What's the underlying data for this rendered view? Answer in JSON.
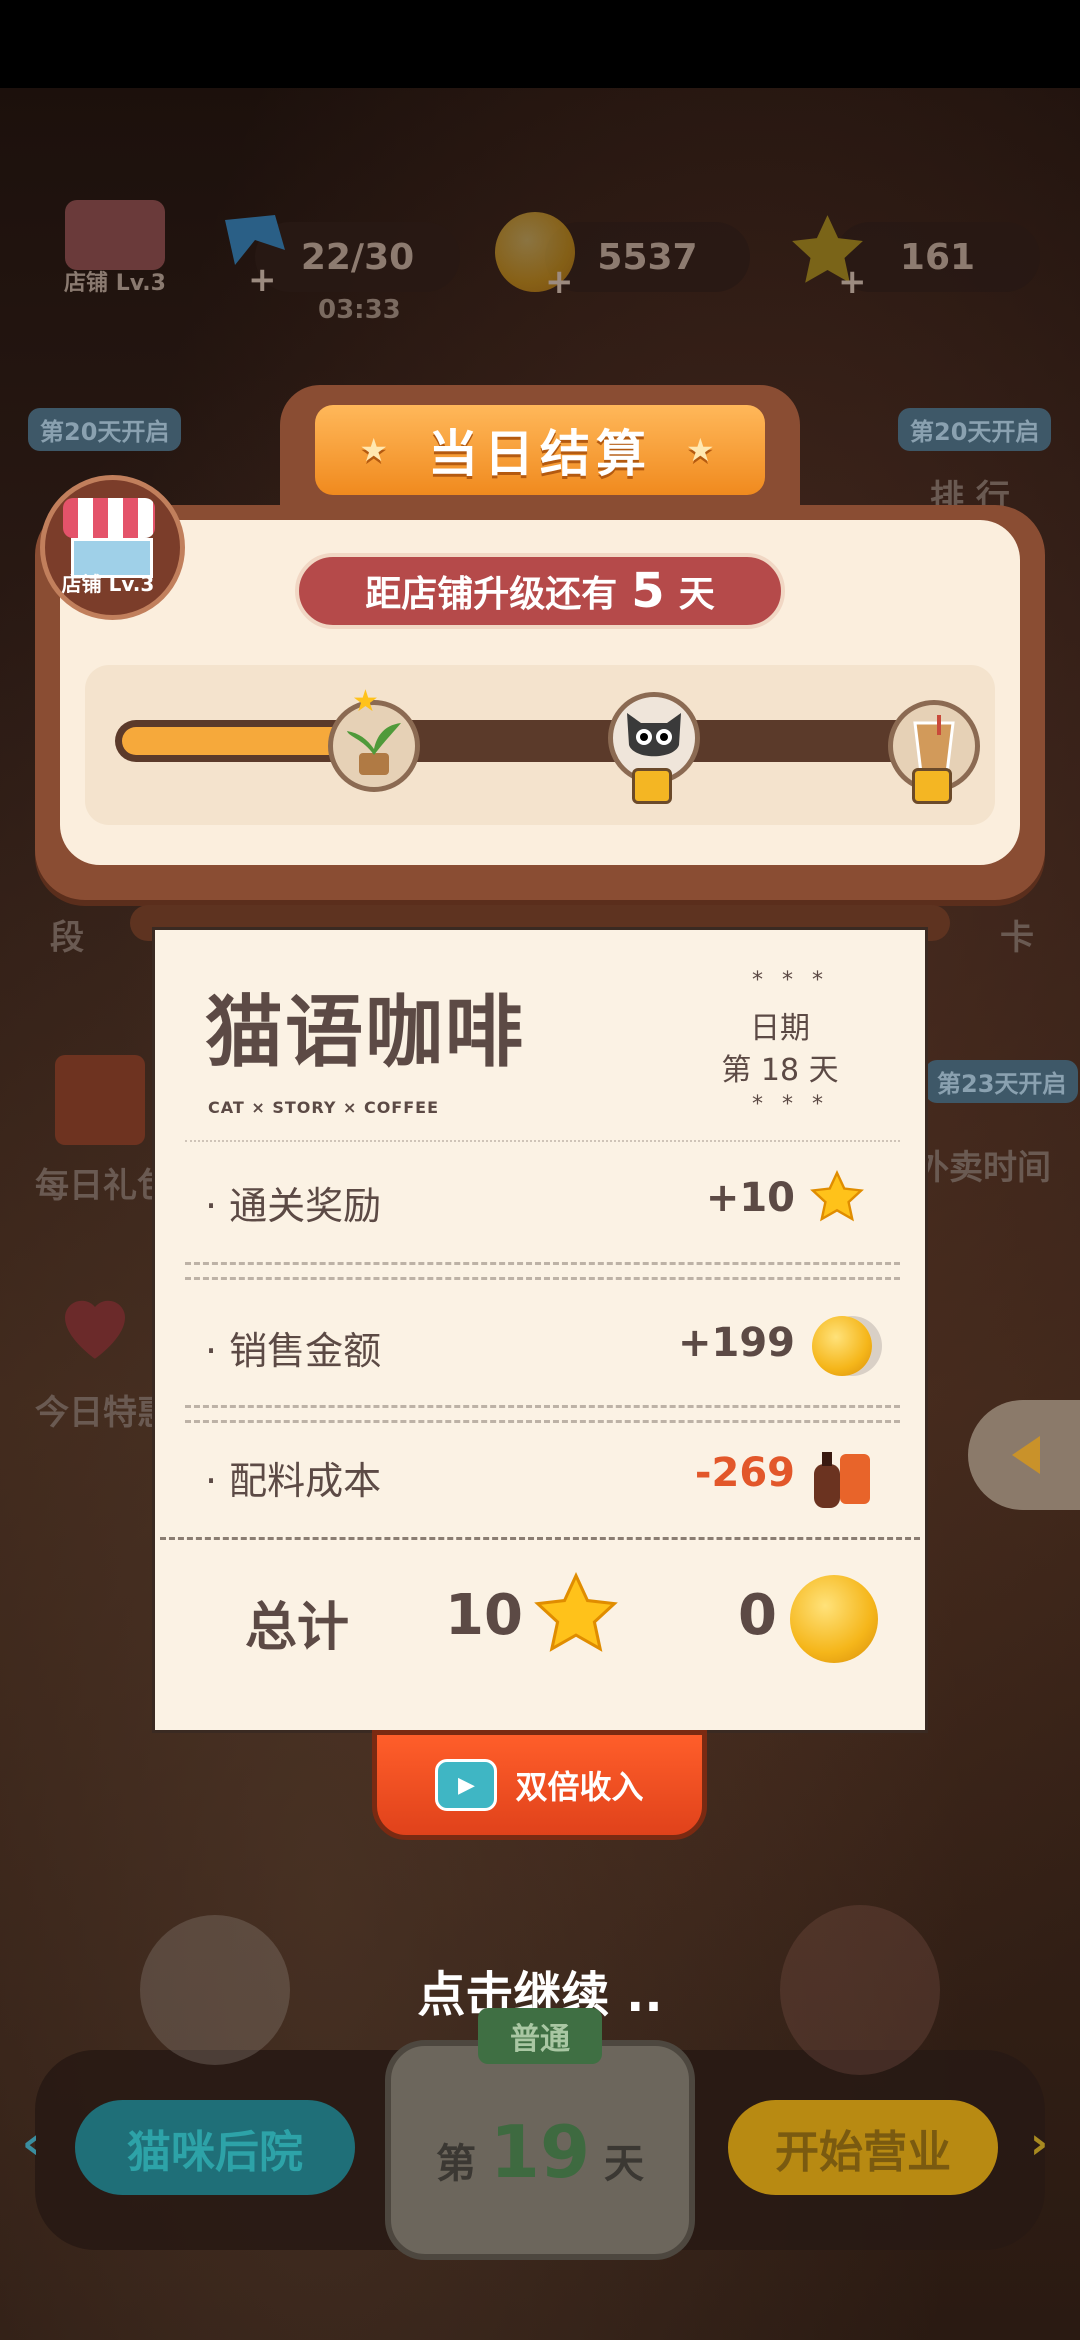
{
  "top_bar": {
    "shop_level": "店铺 Lv.3",
    "energy": "22/30",
    "energy_timer": "03:33",
    "coins": "5537",
    "stars": "161",
    "plus": "+"
  },
  "side": {
    "left_badge": "第20天开启",
    "right_badge": "第20天开启",
    "right_label_top": "排 行",
    "left_label_mid": "段",
    "right_label_mid": "卡",
    "left_label_gift": "每日礼包",
    "right_badge_2": "第23天开启",
    "right_label_takeout": "外卖时间",
    "left_label_special": "今日特惠"
  },
  "modal": {
    "title": "当日结算",
    "shop_badge": "店铺 Lv.3",
    "upgrade_prefix": "距店铺升级还有",
    "upgrade_days": "5",
    "upgrade_suffix": "天",
    "progress": 0.35
  },
  "receipt": {
    "logo_main": "猫语咖啡",
    "logo_sub": "CAT × STORY × COFFEE",
    "stars_top": "* * *",
    "date_label": "日期",
    "date_value": "第 18 天",
    "stars_bottom": "* * *",
    "rows": [
      {
        "label": "通关奖励",
        "value": "+10",
        "icon": "star-icon"
      },
      {
        "label": "销售金额",
        "value": "+199",
        "icon": "coin-icon"
      },
      {
        "label": "配料成本",
        "value": "-269",
        "icon": "ingredients-icon"
      }
    ],
    "total_label": "总计",
    "total_stars": "10",
    "total_coins": "0"
  },
  "double_income": "双倍收入",
  "continue_text": "点击继续 ..",
  "bottom": {
    "cat_backyard": "猫咪后院",
    "normal_tag": "普通",
    "day_prefix": "第",
    "day_number": "19",
    "day_suffix": "天",
    "start_business": "开始营业"
  },
  "colors": {
    "accent_orange": "#f6a93b",
    "modal_brown": "#8a4d33",
    "upgrade_red": "#b54a4a",
    "negative": "#e2572a",
    "button_red": "#e0421b"
  }
}
